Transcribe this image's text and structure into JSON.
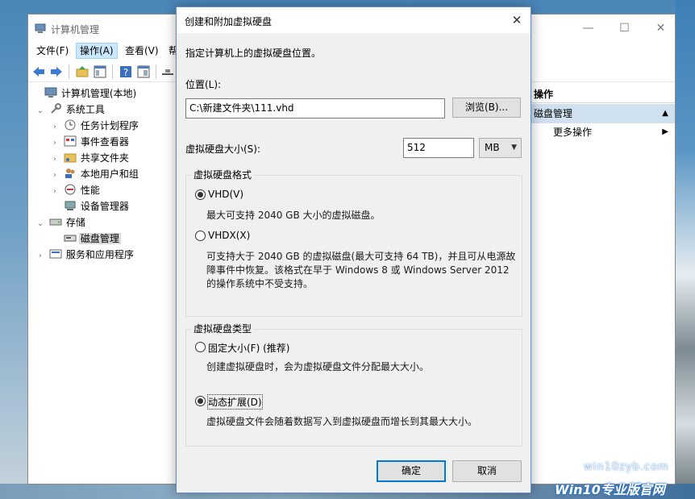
{
  "mmc": {
    "title": "计算机管理",
    "menu": [
      "文件(F)",
      "操作(A)",
      "查看(V)",
      "帮"
    ],
    "window_controls": {
      "minimize": "—",
      "maximize": "☐",
      "close": "✕"
    },
    "tree": [
      {
        "label": "计算机管理(本地)",
        "expander": "",
        "icon": "computer-management-icon"
      },
      {
        "label": "系统工具",
        "expander": "⌄",
        "icon": "tools-icon"
      },
      {
        "label": "任务计划程序",
        "expander": "›",
        "icon": "clock-icon"
      },
      {
        "label": "事件查看器",
        "expander": "›",
        "icon": "event-viewer-icon"
      },
      {
        "label": "共享文件夹",
        "expander": "›",
        "icon": "shared-folder-icon"
      },
      {
        "label": "本地用户和组",
        "expander": "›",
        "icon": "users-icon"
      },
      {
        "label": "性能",
        "expander": "›",
        "icon": "performance-icon"
      },
      {
        "label": "设备管理器",
        "expander": "",
        "icon": "device-manager-icon"
      },
      {
        "label": "存储",
        "expander": "⌄",
        "icon": "storage-icon"
      },
      {
        "label": "磁盘管理",
        "expander": "",
        "icon": "disk-icon",
        "selected": true
      },
      {
        "label": "服务和应用程序",
        "expander": "›",
        "icon": "services-icon"
      }
    ],
    "actions": {
      "header": "操作",
      "section": "磁盘管理",
      "section_caret": "▲",
      "more": "更多操作",
      "more_caret": "▶"
    }
  },
  "dialog": {
    "title": "创建和附加虚拟硬盘",
    "close": "✕",
    "instruction": "指定计算机上的虚拟硬盘位置。",
    "location_label": "位置(L):",
    "location_value": "C:\\新建文件夹\\111.vhd",
    "browse_button": "浏览(B)...",
    "size_label": "虚拟硬盘大小(S):",
    "size_value": "512",
    "size_unit": "MB",
    "format_group": {
      "label": "虚拟硬盘格式",
      "options": [
        {
          "label": "VHD(V)",
          "checked": true,
          "desc": [
            "最大可支持 2040 GB 大小的虚拟磁盘。"
          ]
        },
        {
          "label": "VHDX(X)",
          "checked": false,
          "desc": [
            "可支持大于 2040 GB 的虚拟磁盘(最大可支持 64 TB)，并且可从电源故",
            "障事件中恢复。该格式在早于 Windows 8 或 Windows Server 2012",
            "的操作系统中不受支持。"
          ]
        }
      ]
    },
    "type_group": {
      "label": "虚拟硬盘类型",
      "options": [
        {
          "label": "固定大小(F) (推荐)",
          "checked": false,
          "desc": [
            "创建虚拟硬盘时，会为虚拟硬盘文件分配最大大小。"
          ]
        },
        {
          "label": "动态扩展(D)",
          "checked": true,
          "desc": [
            "虚拟硬盘文件会随着数据写入到虚拟硬盘而增长到其最大大小。"
          ]
        }
      ]
    },
    "ok_button": "确定",
    "cancel_button": "取消"
  },
  "watermark": {
    "line1": "win10zyb.com",
    "line2": "Win10专业版官网"
  },
  "colors": {
    "accent": "#0078d7",
    "selection": "#cfe0f0",
    "dialog_bg": "#f0f0f0"
  }
}
